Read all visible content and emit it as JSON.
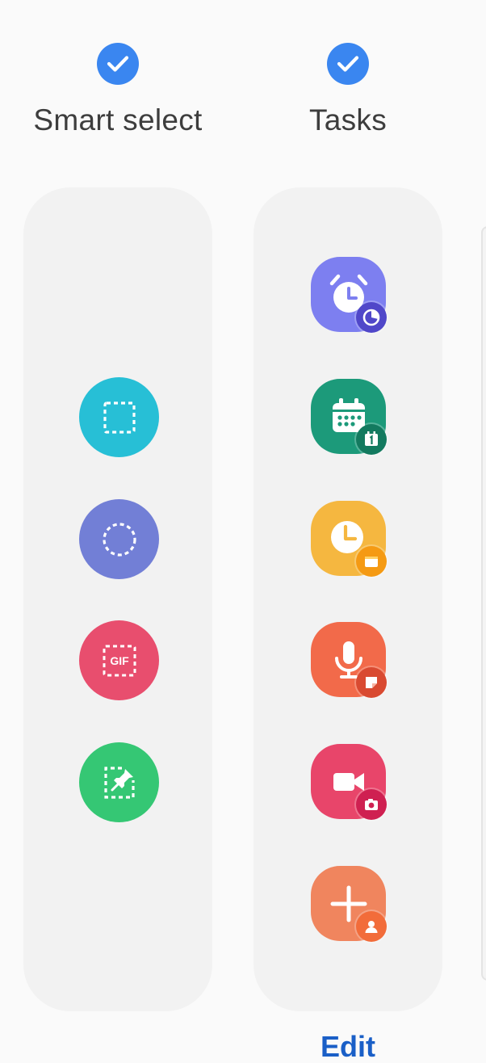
{
  "panels": [
    {
      "title": "Smart select",
      "selected": true,
      "tools": [
        {
          "name": "Rectangle",
          "icon": "dashed-rectangle-icon",
          "color": "#27bfd6"
        },
        {
          "name": "Oval",
          "icon": "dashed-oval-icon",
          "color": "#727fd6"
        },
        {
          "name": "Animation",
          "icon": "gif-icon",
          "color": "#e84e6e"
        },
        {
          "name": "Pin to screen",
          "icon": "pin-icon",
          "color": "#35c774"
        }
      ]
    },
    {
      "title": "Tasks",
      "selected": true,
      "tasks": [
        {
          "name": "Create alarm",
          "icon": "alarm-clock-icon",
          "badge_icon": "timer-badge-icon",
          "color": "#7d7ff0",
          "badge_color": "#5047c9"
        },
        {
          "name": "Create event",
          "icon": "calendar-icon",
          "badge_icon": "calendar-day-badge-icon",
          "color": "#1c9a7a",
          "badge_color": "#137a5f"
        },
        {
          "name": "Create reminder",
          "icon": "reminder-clock-icon",
          "badge_icon": "card-badge-icon",
          "color": "#f5b740",
          "badge_color": "#f59a13"
        },
        {
          "name": "Record voice",
          "icon": "microphone-icon",
          "badge_icon": "note-badge-icon",
          "color": "#f26a4a",
          "badge_color": "#d94a31"
        },
        {
          "name": "Record video",
          "icon": "video-camera-icon",
          "badge_icon": "camera-badge-icon",
          "color": "#e8456a",
          "badge_color": "#cf2051"
        },
        {
          "name": "Add contact",
          "icon": "plus-icon",
          "badge_icon": "person-badge-icon",
          "color": "#f0855e",
          "badge_color": "#f26c3a"
        }
      ]
    }
  ],
  "footer": {
    "edit_label": "Edit"
  },
  "colors": {
    "accent": "#3a86f0",
    "panel_bg": "#f2f2f2",
    "page_bg": "#fafafa",
    "link": "#1a5fc7"
  }
}
